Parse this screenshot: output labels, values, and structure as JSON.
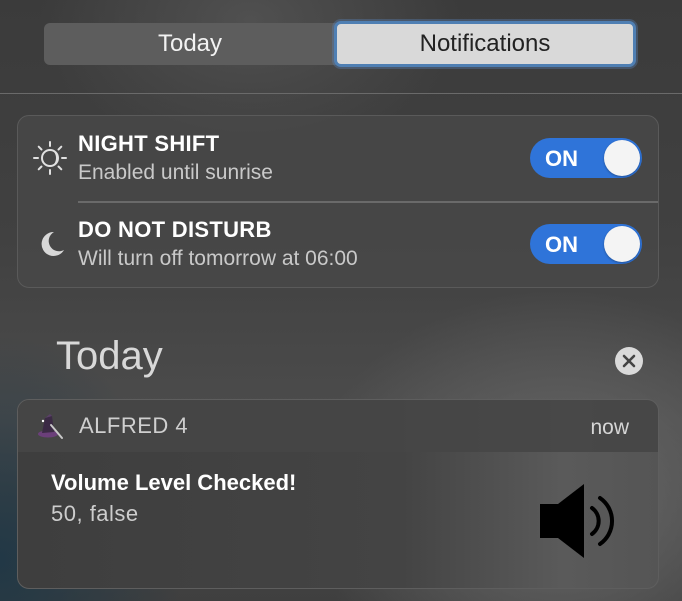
{
  "tabs": {
    "today": "Today",
    "notifications": "Notifications",
    "selected": "notifications"
  },
  "widgets": [
    {
      "title": "NIGHT SHIFT",
      "subtitle": "Enabled until sunrise",
      "toggle": "ON",
      "icon": "night-shift-icon"
    },
    {
      "title": "DO NOT DISTURB",
      "subtitle": "Will turn off tomorrow at 06:00",
      "toggle": "ON",
      "icon": "moon-icon"
    }
  ],
  "section": {
    "heading": "Today",
    "clear_icon": "close-icon"
  },
  "notification": {
    "app_name": "ALFRED 4",
    "time": "now",
    "title": "Volume Level Checked!",
    "body": "50, false",
    "app_icon": "alfred-hat-icon",
    "image_icon": "speaker-volume-icon"
  },
  "colors": {
    "toggle_on": "#2f74d9",
    "selected_tab_border": "#4f7fb3"
  }
}
